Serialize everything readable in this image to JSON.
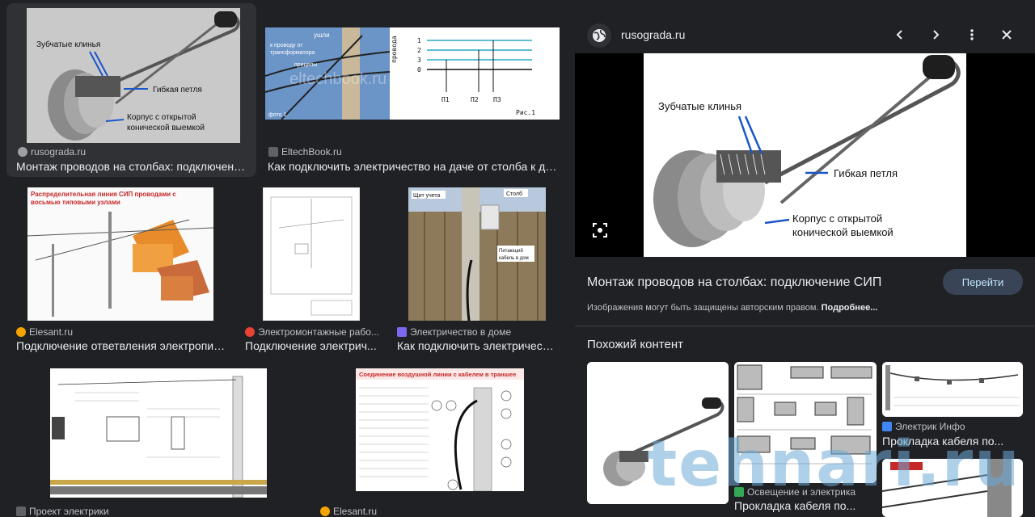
{
  "results": [
    {
      "source": "rusograda.ru",
      "title": "Монтаж проводов на столбах: подключение ...",
      "fav": "#9aa0a6",
      "labels": [
        "Зубчатые клинья",
        "Гибкая петля",
        "Корпус с открытой",
        "конической выемкой"
      ]
    },
    {
      "source": "EltechBook.ru",
      "title": "Как подключить электричество на даче от столба к дому",
      "fav": "#5f6368",
      "labels": [
        "ушли",
        "к проводу от",
        "трансформатора",
        "прицепы",
        "фото 1",
        "eltechbook.ru",
        "провода",
        "1",
        "2",
        "3",
        "0",
        "П1",
        "П2",
        "П3",
        "Рис.1"
      ]
    },
    {
      "source": "Elesant.ru",
      "title": "Подключение ответвления электропит...",
      "fav": "#f4a300",
      "labels": [
        "Распределительная линия СИП проводами с",
        "восьмью типовыми узлами"
      ]
    },
    {
      "source": "Электромонтажные рабо...",
      "title": "Подключение электрич...",
      "fav": "#ea4335"
    },
    {
      "source": "Электричество в доме",
      "title": "Как подключить электричеств...",
      "fav": "#7b68ee",
      "labels": [
        "Щит учета",
        "Столб",
        "Питающий",
        "кабель в дом"
      ]
    },
    {
      "source": "Проект электрики",
      "title": "",
      "fav": "#5f6368"
    },
    {
      "source": "Elesant.ru",
      "title": "",
      "fav": "#f4a300",
      "labels": [
        "Соединение воздушной линии с кабелем в траншее"
      ]
    }
  ],
  "panel": {
    "site": "rusograda.ru",
    "title": "Монтаж проводов на столбах: подключение СИП",
    "go_label": "Перейти",
    "copyright_text": "Изображения могут быть защищены авторским правом.",
    "copyright_more": "Подробнее...",
    "preview_labels": [
      "Зубчатые клинья",
      "Гибкая петля",
      "Корпус с открытой",
      "конической выемкой"
    ],
    "similar_heading": "Похожий контент",
    "similar": [
      {
        "source": "",
        "title": ""
      },
      {
        "source": "Освещение и электрика",
        "title": "Прокладка кабеля по...",
        "fav": "#34a853"
      },
      {
        "source": "Электрик Инфо",
        "title": "Прокладка кабеля по...",
        "fav": "#4285f4"
      }
    ],
    "watermark": "tehnari.ru"
  },
  "icons": {
    "globe": "globe-icon",
    "prev": "chevron-left-icon",
    "next": "chevron-right-icon",
    "more": "more-vert-icon",
    "close": "close-icon",
    "lens": "lens-icon"
  }
}
